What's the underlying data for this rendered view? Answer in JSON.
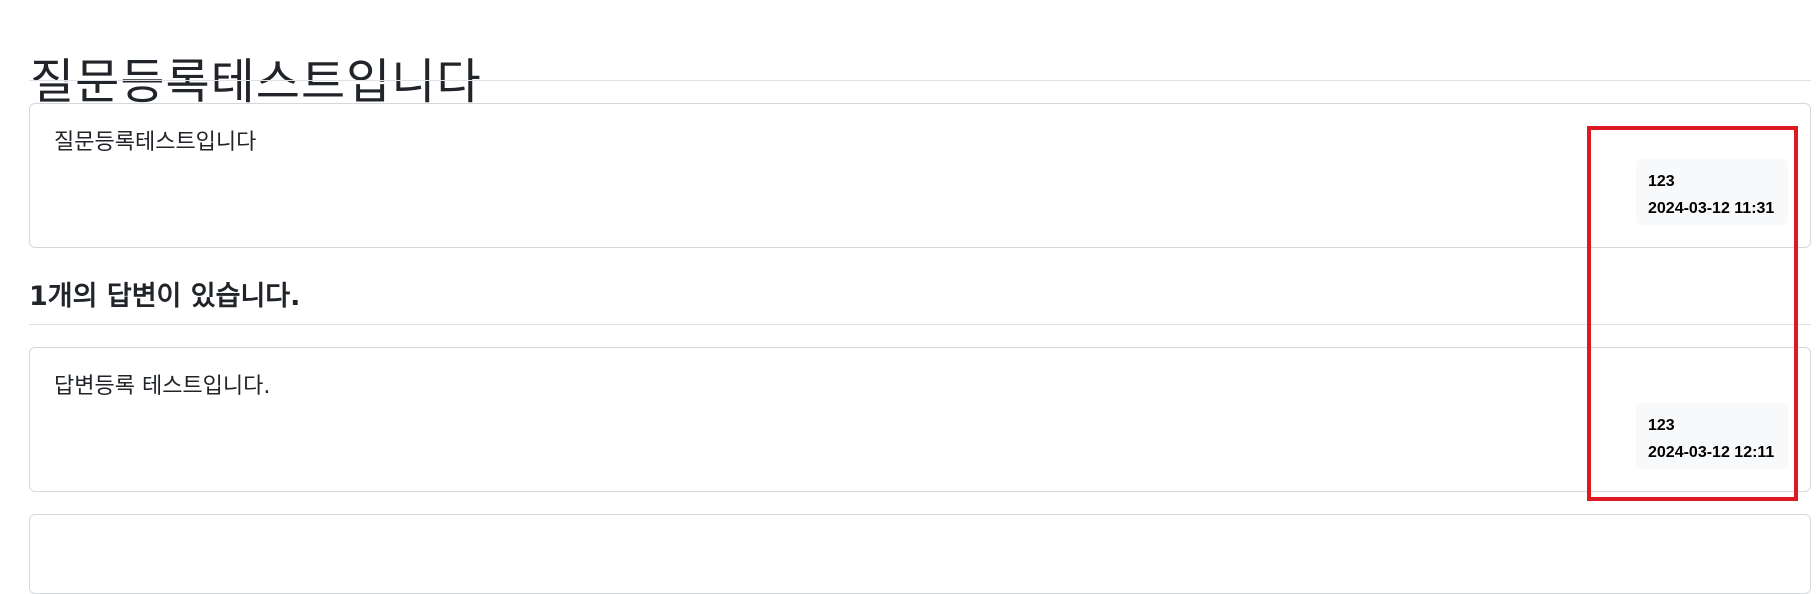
{
  "question": {
    "subject": "질문등록테스트입니다",
    "content": "질문등록테스트입니다",
    "author": "123",
    "created_at": "2024-03-12 11:31"
  },
  "answer_count_label": "1개의 답변이 있습니다.",
  "answers": [
    {
      "content": "답변등록 테스트입니다.",
      "author": "123",
      "created_at": "2024-03-12 12:11"
    }
  ],
  "colors": {
    "highlight": "#dd1a22",
    "badge_bg": "#f8f9fa",
    "border": "#d6d8db"
  }
}
